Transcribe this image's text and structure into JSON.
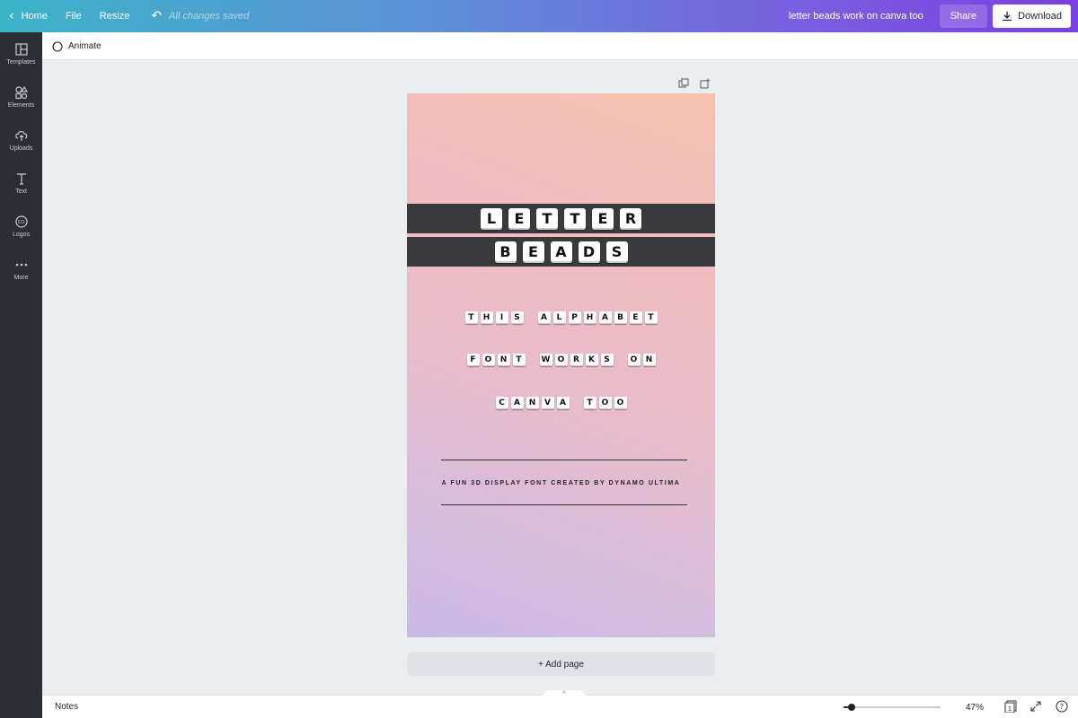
{
  "topbar": {
    "home_label": "Home",
    "file_label": "File",
    "resize_label": "Resize",
    "saved_status": "All changes saved",
    "doc_title": "letter beads work on canva too",
    "share_label": "Share",
    "download_label": "Download"
  },
  "sidebar": {
    "items": [
      {
        "label": "Templates",
        "icon": "templates-icon"
      },
      {
        "label": "Elements",
        "icon": "elements-icon"
      },
      {
        "label": "Uploads",
        "icon": "uploads-icon"
      },
      {
        "label": "Text",
        "icon": "text-icon"
      },
      {
        "label": "Logos",
        "icon": "logos-icon"
      },
      {
        "label": "More",
        "icon": "more-icon"
      }
    ]
  },
  "toolbar": {
    "animate_label": "Animate"
  },
  "design": {
    "title_line1": [
      "L",
      "E",
      "T",
      "T",
      "E",
      "R"
    ],
    "title_line2": [
      "B",
      "E",
      "A",
      "D",
      "S"
    ],
    "body_lines": [
      [
        "T",
        "H",
        "I",
        "S",
        " ",
        "A",
        "L",
        "P",
        "H",
        "A",
        "B",
        "E",
        "T"
      ],
      [
        "F",
        "O",
        "N",
        "T",
        " ",
        "W",
        "O",
        "R",
        "K",
        "S",
        " ",
        "O",
        "N"
      ],
      [
        "C",
        "A",
        "N",
        "V",
        "A",
        " ",
        "T",
        "O",
        "O"
      ]
    ],
    "tagline": "A FUN 3D DISPLAY FONT CREATED BY DYNAMO ULTIMA",
    "colors": {
      "band": "#3a3a3c",
      "gradient_top": "#f4c1ae",
      "gradient_bottom": "#c9b8e8"
    }
  },
  "add_page_label": "+ Add page",
  "bottombar": {
    "notes_label": "Notes",
    "zoom_value": "47%",
    "zoom_fraction": 0.08,
    "page_count": "1"
  }
}
